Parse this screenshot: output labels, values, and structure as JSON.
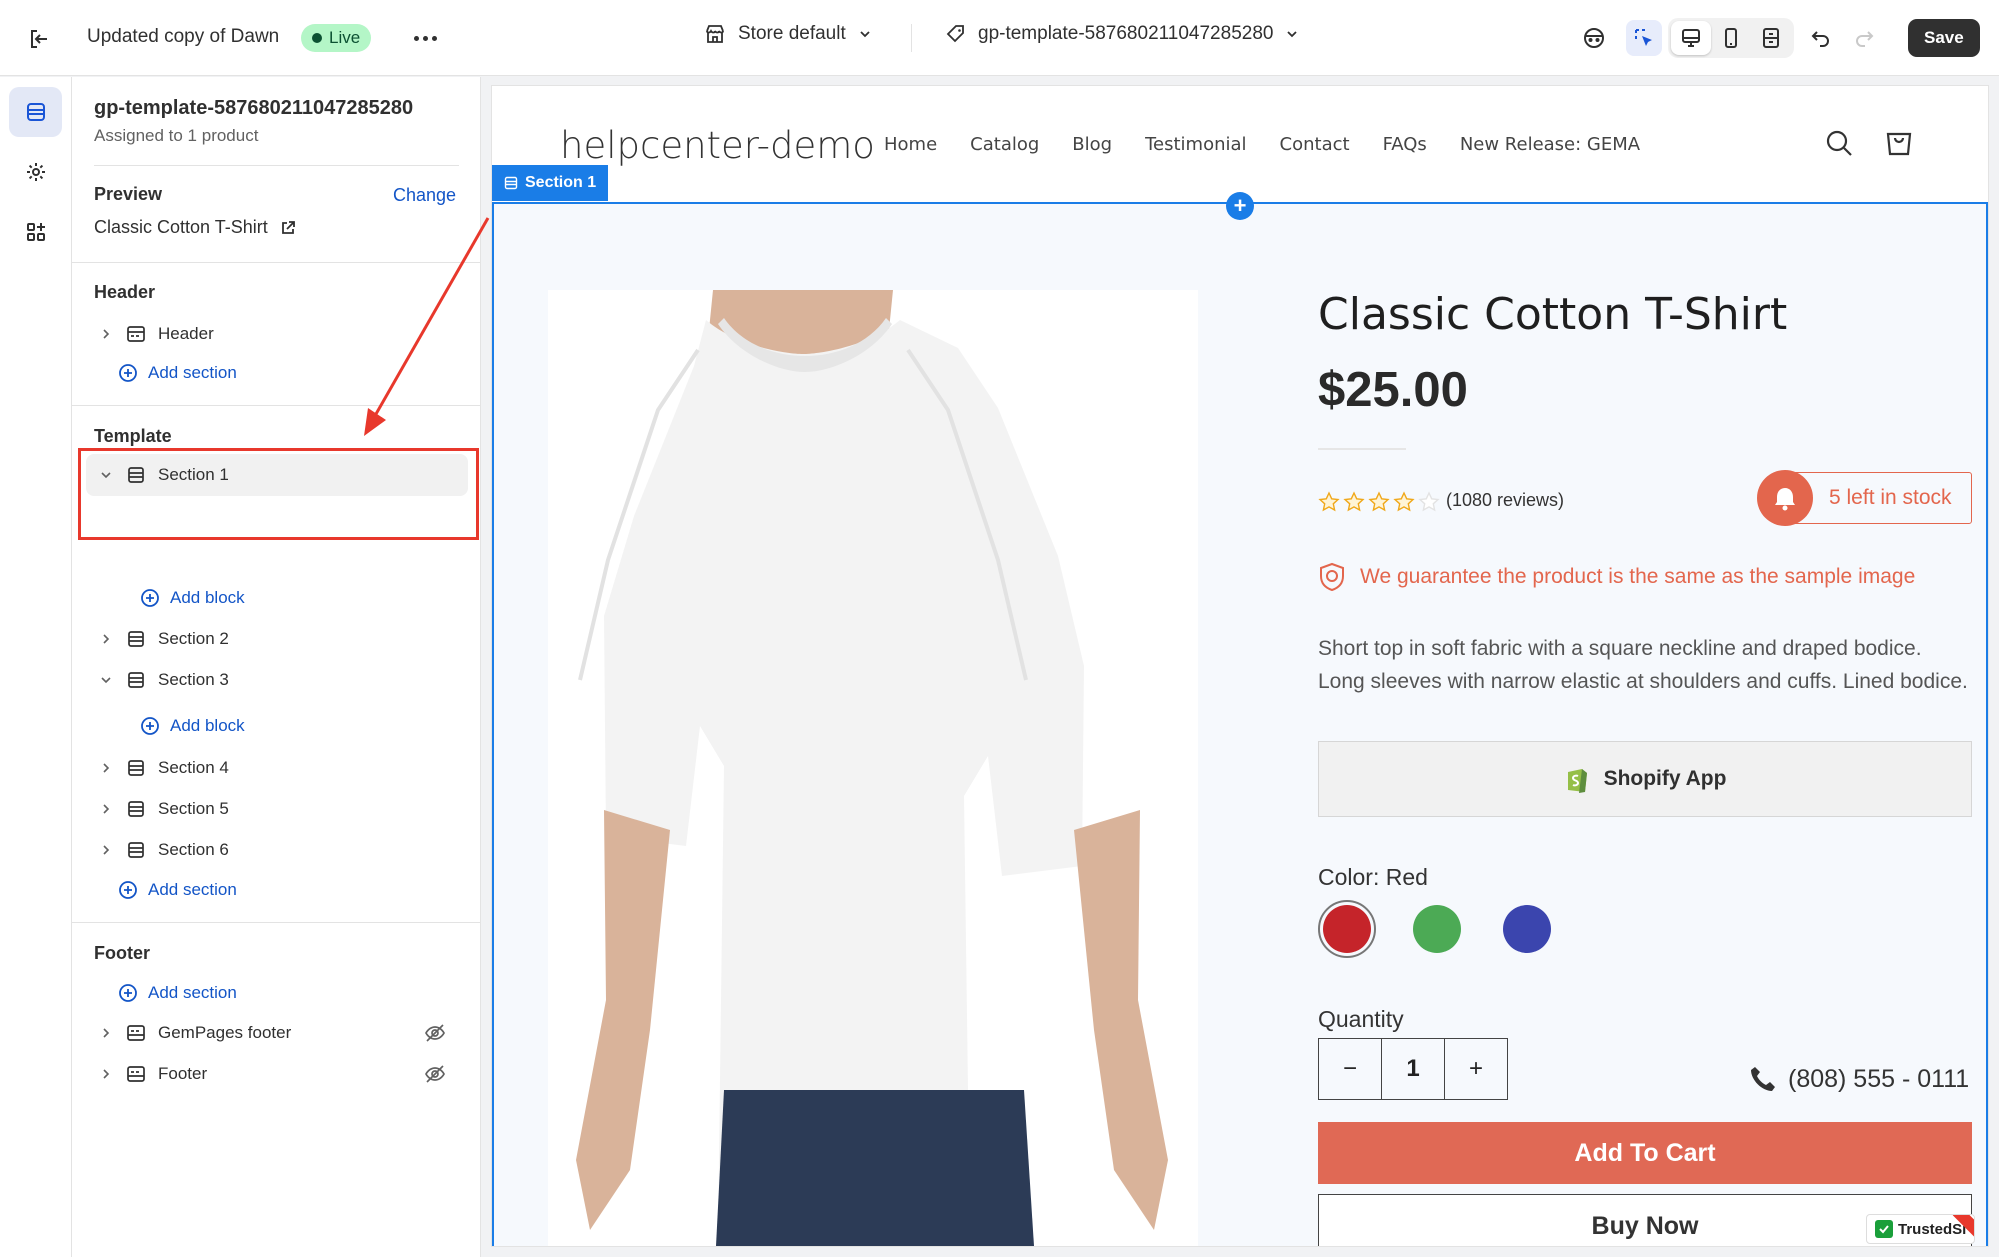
{
  "topbar": {
    "store_name": "Updated copy of Dawn",
    "live_label": "Live",
    "store_select": "Store default",
    "template_select": "gp-template-587680211047285280",
    "save_label": "Save"
  },
  "panel": {
    "template_title": "gp-template-587680211047285280",
    "assigned_text": "Assigned to 1 product",
    "preview_heading": "Preview",
    "change_label": "Change",
    "preview_product": "Classic Cotton T-Shirt",
    "header_heading": "Header",
    "header_item": "Header",
    "add_section": "Add section",
    "add_block": "Add block",
    "template_heading": "Template",
    "sections": [
      "Section 1",
      "Section 2",
      "Section 3",
      "Section 4",
      "Section 5",
      "Section 6"
    ],
    "footer_heading": "Footer",
    "footer_items": [
      "GemPages footer",
      "Footer"
    ]
  },
  "storefront": {
    "brand": "helpcenter-demo",
    "nav": [
      "Home",
      "Catalog",
      "Blog",
      "Testimonial",
      "Contact",
      "FAQs",
      "New Release: GEMA"
    ],
    "section_tag": "Section 1",
    "product": {
      "title": "Classic Cotton T-Shirt",
      "price": "$25.00",
      "rating": 4,
      "rating_max": 5,
      "reviews": "(1080 reviews)",
      "stock": "5 left in stock",
      "guarantee": "We guarantee the product is the same as the sample image",
      "description_line1": "Short top in soft fabric with a square neckline and draped bodice.",
      "description_line2": "Long sleeves with narrow elastic at shoulders and cuffs. Lined bodice.",
      "shopify_app": "Shopify App",
      "color_label": "Color: Red",
      "swatches": [
        "#c5242a",
        "#4caa55",
        "#3b45ae"
      ],
      "quantity_label": "Quantity",
      "quantity_minus": "−",
      "quantity": "1",
      "quantity_plus": "+",
      "phone": "(808) 555 - 0111",
      "add_to_cart": "Add To Cart",
      "buy_now": "Buy Now",
      "trusted": "TrustedSi"
    }
  },
  "colors": {
    "accent_blue": "#1a7de7",
    "link_blue": "#1355c7",
    "annotation_red": "#e8382c",
    "sale_red": "#e06955"
  }
}
